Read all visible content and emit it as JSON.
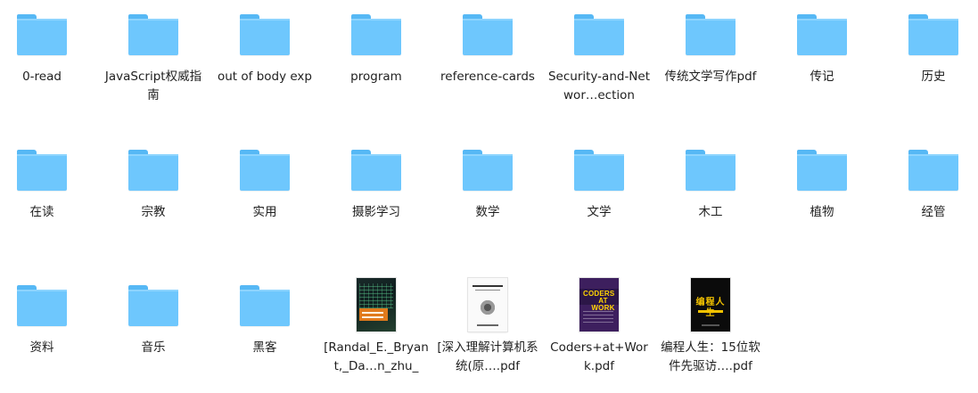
{
  "items": [
    {
      "label": "0-read",
      "type": "folder",
      "icon": "folder-icon"
    },
    {
      "label": "JavaScript权威指南",
      "type": "folder",
      "icon": "folder-icon"
    },
    {
      "label": "out of body exp",
      "type": "folder",
      "icon": "folder-icon"
    },
    {
      "label": "program",
      "type": "folder",
      "icon": "folder-icon"
    },
    {
      "label": "reference-cards",
      "type": "folder",
      "icon": "folder-icon"
    },
    {
      "label": "Security-and-Networ…ection",
      "type": "folder",
      "icon": "folder-icon"
    },
    {
      "label": "传统文学写作pdf",
      "type": "folder",
      "icon": "folder-icon"
    },
    {
      "label": "传记",
      "type": "folder",
      "icon": "folder-icon"
    },
    {
      "label": "历史",
      "type": "folder",
      "icon": "folder-icon"
    },
    {
      "label": "在读",
      "type": "folder",
      "icon": "folder-icon"
    },
    {
      "label": "宗教",
      "type": "folder",
      "icon": "folder-icon"
    },
    {
      "label": "实用",
      "type": "folder",
      "icon": "folder-icon"
    },
    {
      "label": "摄影学习",
      "type": "folder",
      "icon": "folder-icon"
    },
    {
      "label": "数学",
      "type": "folder",
      "icon": "folder-icon"
    },
    {
      "label": "文学",
      "type": "folder",
      "icon": "folder-icon"
    },
    {
      "label": "木工",
      "type": "folder",
      "icon": "folder-icon"
    },
    {
      "label": "植物",
      "type": "folder",
      "icon": "folder-icon"
    },
    {
      "label": "经管",
      "type": "folder",
      "icon": "folder-icon"
    },
    {
      "label": "资料",
      "type": "folder",
      "icon": "folder-icon"
    },
    {
      "label": "音乐",
      "type": "folder",
      "icon": "folder-icon"
    },
    {
      "label": "黑客",
      "type": "folder",
      "icon": "folder-icon"
    },
    {
      "label": "[Randal_E._Bryant,_Da…n_zhu_",
      "type": "file",
      "icon": "book-cover-icon",
      "cover": "b1"
    },
    {
      "label": "[深入理解计算机系统(原….pdf",
      "type": "file",
      "icon": "book-cover-icon",
      "cover": "b2"
    },
    {
      "label": "Coders+at+Work.pdf",
      "type": "file",
      "icon": "book-cover-icon",
      "cover": "b3",
      "cover_text": [
        "CODERS",
        "AT WORK"
      ]
    },
    {
      "label": "编程人生：15位软件先驱访….pdf",
      "type": "file",
      "icon": "book-cover-icon",
      "cover": "b4",
      "cover_text": [
        "编程人生"
      ]
    }
  ],
  "colors": {
    "folder_body": "#6ec7fd",
    "folder_tab": "#56b8f5",
    "label_text": "#1f1f1f",
    "background": "#ffffff"
  }
}
